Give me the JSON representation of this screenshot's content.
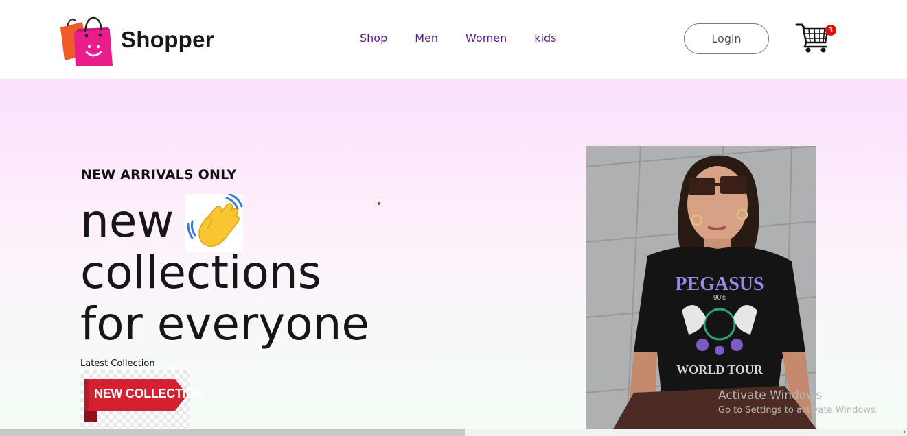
{
  "brand": {
    "name": "Shopper"
  },
  "nav": {
    "items": [
      {
        "label": "Shop"
      },
      {
        "label": "Men"
      },
      {
        "label": "Women"
      },
      {
        "label": "kids"
      }
    ]
  },
  "header": {
    "login_label": "Login",
    "cart_count": "3"
  },
  "hero": {
    "tagline": "NEW ARRIVALS ONLY",
    "line1": "new",
    "line2": "collections",
    "line3": "for everyone",
    "latest_label": "Latest Collection",
    "badge_text": "NEW COLLECTION",
    "photo_print": {
      "top": "PEGASUS",
      "mid": "90's",
      "bottom": "WORLD TOUR"
    }
  },
  "os_overlay": {
    "title": "Activate Windows",
    "subtitle": "Go to Settings to activate Windows."
  },
  "colors": {
    "nav_text": "#5a1d8a",
    "logo_bag_pink": "#e91e8c",
    "logo_bag_orange": "#f05a28",
    "cart_badge": "#e01010",
    "badge_red": "#d4212f",
    "hero_gradient_top": "#fbe0fc",
    "hero_gradient_bottom": "#f3fdf6"
  },
  "icons": {
    "logo": "shopping-bag-smile-icon",
    "cart": "shopping-cart-icon",
    "hand": "waving-hand-icon"
  }
}
